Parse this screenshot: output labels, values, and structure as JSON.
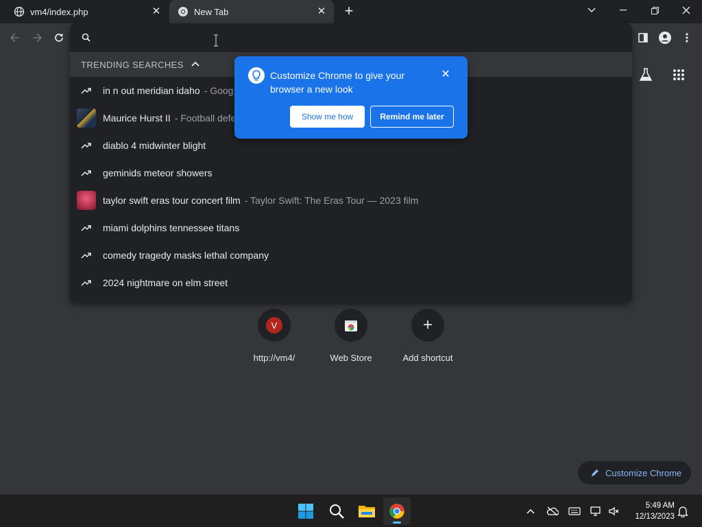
{
  "tabs": [
    {
      "title": "vm4/index.php",
      "favicon": "globe-icon"
    },
    {
      "title": "New Tab",
      "favicon": "chrome-icon"
    }
  ],
  "omnibox": {
    "header": "TRENDING SEARCHES",
    "suggestions": [
      {
        "text": "in n out meridian idaho",
        "sub": "- Goog",
        "icon": "trending-icon"
      },
      {
        "text": "Maurice Hurst II",
        "sub": "- Football defe",
        "icon": "thumbnail"
      },
      {
        "text": "diablo 4 midwinter blight",
        "sub": "",
        "icon": "trending-icon"
      },
      {
        "text": "geminids meteor showers",
        "sub": "",
        "icon": "trending-icon"
      },
      {
        "text": "taylor swift eras tour concert film",
        "sub": "- Taylor Swift: The Eras Tour — 2023 film",
        "icon": "thumbnail"
      },
      {
        "text": "miami dolphins tennessee titans",
        "sub": "",
        "icon": "trending-icon"
      },
      {
        "text": "comedy tragedy masks lethal company",
        "sub": "",
        "icon": "trending-icon"
      },
      {
        "text": "2024 nightmare on elm street",
        "sub": "",
        "icon": "trending-icon"
      }
    ]
  },
  "promo": {
    "message": "Customize Chrome to give your browser a new look",
    "primary": "Show me how",
    "secondary": "Remind me later"
  },
  "shortcuts": [
    {
      "label": "http://vm4/",
      "letter": "V"
    },
    {
      "label": "Web Store",
      "letter": ""
    },
    {
      "label": "Add shortcut",
      "letter": "+"
    }
  ],
  "customize_button": "Customize Chrome",
  "clock": {
    "time": "5:49 AM",
    "date": "12/13/2023"
  },
  "colors": {
    "accent": "#1a73e8",
    "link": "#8ab4f8"
  }
}
